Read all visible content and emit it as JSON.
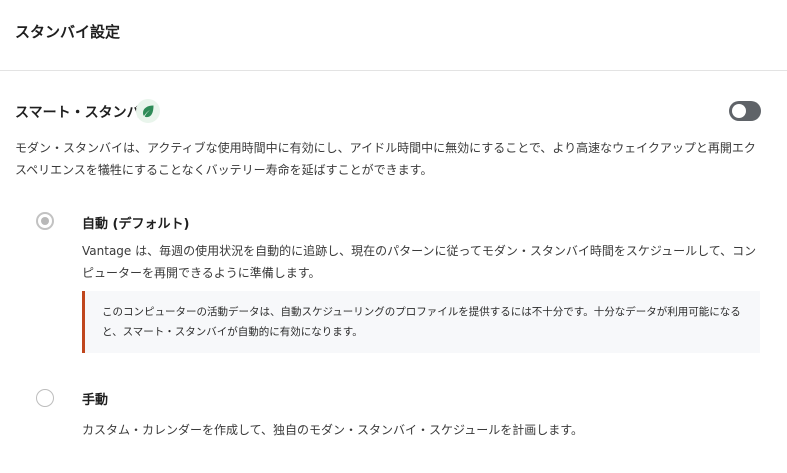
{
  "page": {
    "title": "スタンバイ設定"
  },
  "smart_standby": {
    "title": "スマート・スタンバイ",
    "icon": "leaf-icon",
    "toggle_state": "off",
    "description": "モダン・スタンバイは、アクティブな使用時間中に有効にし、アイドル時間中に無効にすることで、より高速なウェイクアップと再開エクスペリエンスを犠牲にすることなくバッテリー寿命を延ばすことができます。"
  },
  "options": {
    "auto": {
      "title": "自動 (デフォルト)",
      "selected": true,
      "description": "Vantage は、毎週の使用状況を自動的に追跡し、現在のパターンに従ってモダン・スタンバイ時間をスケジュールして、コンピューターを再開できるように準備します。",
      "notice": "このコンピューターの活動データは、自動スケジューリングのプロファイルを提供するには不十分です。十分なデータが利用可能になると、スマート・スタンバイが自動的に有効になります。"
    },
    "manual": {
      "title": "手動",
      "selected": false,
      "description": "カスタム・カレンダーを作成して、独自のモダン・スタンバイ・スケジュールを計画します。"
    }
  },
  "colors": {
    "accent_notice": "#c0461d",
    "leaf": "#2e8b57",
    "toggle_off": "#5f6368"
  }
}
